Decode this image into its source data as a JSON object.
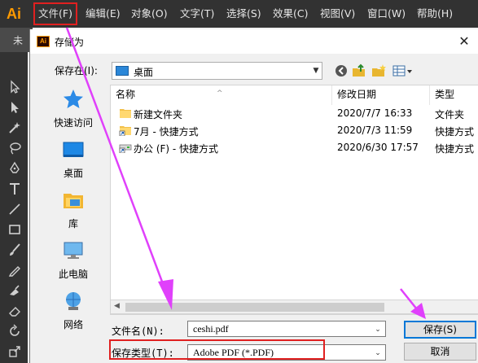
{
  "app": {
    "logo_text": "Ai",
    "menu": [
      "文件(F)",
      "编辑(E)",
      "对象(O)",
      "文字(T)",
      "选择(S)",
      "效果(C)",
      "视图(V)",
      "窗口(W)",
      "帮助(H)"
    ],
    "document_tab_label": "未"
  },
  "dialog": {
    "icon_text": "Ai",
    "title": "存储为",
    "close_glyph": "✕",
    "save_in_label": "保存在(I):",
    "save_in_value": "桌面",
    "places": [
      "快速访问",
      "桌面",
      "库",
      "此电脑",
      "网络"
    ],
    "columns": [
      "名称",
      "修改日期",
      "类型"
    ],
    "files": [
      {
        "name": "新建文件夹",
        "date": "2020/7/7 16:33",
        "type": "文件夹",
        "icon": "folder-icon"
      },
      {
        "name": "7月 - 快捷方式",
        "date": "2020/7/3 11:59",
        "type": "快捷方式",
        "icon": "shortcut-icon"
      },
      {
        "name": "办公 (F) - 快捷方式",
        "date": "2020/6/30 17:57",
        "type": "快捷方式",
        "icon": "drive-shortcut-icon"
      }
    ],
    "filename_label": "文件名(N):",
    "filename_value": "ceshi.pdf",
    "filetype_label": "保存类型(T):",
    "filetype_value": "Adobe PDF (*.PDF)",
    "save_button": "保存(S)",
    "cancel_button": "取消"
  },
  "colors": {
    "highlight": "#e02020",
    "annotation_arrow": "#e040fb",
    "ai_orange": "#ff9a00"
  }
}
